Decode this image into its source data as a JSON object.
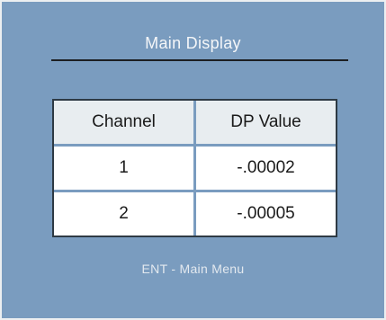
{
  "screen": {
    "title": "Main Display",
    "footer": "ENT - Main Menu"
  },
  "table": {
    "headers": [
      "Channel",
      "DP Value"
    ],
    "rows": [
      [
        "1",
        "-.00002"
      ],
      [
        "2",
        "-.00005"
      ]
    ]
  },
  "colors": {
    "background": "#7a9cbf",
    "header_cell": "#e8edf0",
    "cell": "#ffffff",
    "rule": "#1c1f22"
  }
}
